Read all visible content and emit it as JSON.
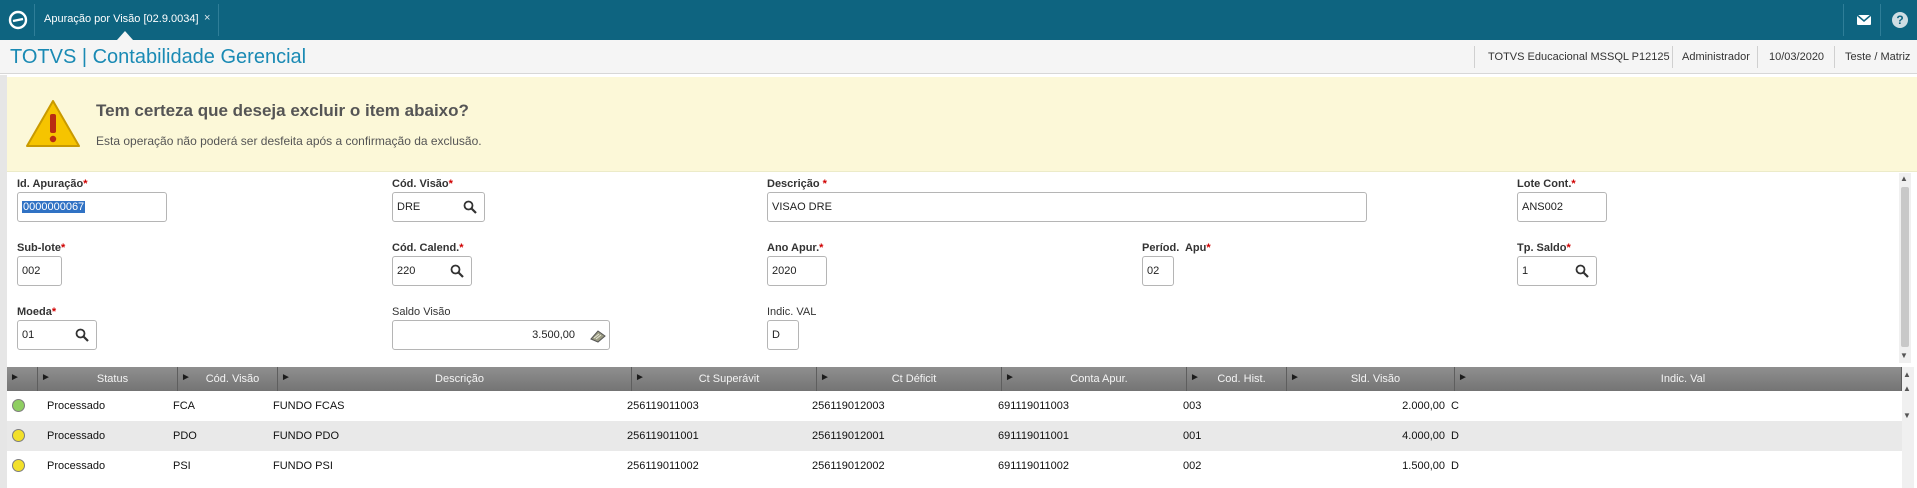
{
  "topbar": {
    "tab_label": "Apuração por Visão [02.9.0034]",
    "tab_close": "×",
    "color": "#0e6480"
  },
  "header": {
    "app_title": "TOTVS | Contabilidade Gerencial",
    "environment": "TOTVS Educacional MSSQL P12125",
    "user": "Administrador",
    "date": "10/03/2020",
    "branch": "Teste / Matriz"
  },
  "warning": {
    "title": "Tem certeza que deseja excluir o item abaixo?",
    "message": "Esta operação não poderá ser desfeita após a confirmação da exclusão.",
    "background": "#fcf8d8"
  },
  "form": {
    "id_apuracao": {
      "label": "Id. Apuração",
      "value": "0000000067"
    },
    "cod_visao": {
      "label": "Cód. Visão",
      "value": "DRE"
    },
    "descricao": {
      "label": "Descrição ",
      "value": "VISAO DRE"
    },
    "lote_cont": {
      "label": "Lote Cont.",
      "value": "ANS002"
    },
    "sub_lote": {
      "label": "Sub-lote",
      "value": "002"
    },
    "cod_calend": {
      "label": "Cód. Calend.",
      "value": "220"
    },
    "ano_apur": {
      "label": "Ano Apur.",
      "value": "2020"
    },
    "period_apu": {
      "label": "Períod.  Apu",
      "value": "02"
    },
    "tp_saldo": {
      "label": "Tp. Saldo",
      "value": "1"
    },
    "moeda": {
      "label": "Moeda",
      "value": "01"
    },
    "saldo_visao": {
      "label": "Saldo Visão",
      "value": "3.500,00"
    },
    "indic_val": {
      "label": "Indic. VAL",
      "value": "D"
    },
    "required_mark": "*"
  },
  "grid": {
    "columns": [
      "Status",
      "Cód. Visão",
      "Descrição",
      "Ct Superávit",
      "Ct Déficit",
      "Conta Apur.",
      "Cod. Hist.",
      "Sld. Visão",
      "Indic. Val"
    ],
    "rows": [
      {
        "status_color": "#8fce62",
        "status": "Processado",
        "cod_visao": "FCA",
        "descricao": "FUNDO FCAS",
        "ct_superavit": "256119011003",
        "ct_deficit": "256119012003",
        "conta_apur": "691119011003",
        "cod_hist": "003",
        "sld_visao": "2.000,00",
        "indic_val": "C"
      },
      {
        "status_color": "#f2e02a",
        "status": "Processado",
        "cod_visao": "PDO",
        "descricao": "FUNDO PDO",
        "ct_superavit": "256119011001",
        "ct_deficit": "256119012001",
        "conta_apur": "691119011001",
        "cod_hist": "001",
        "sld_visao": "4.000,00",
        "indic_val": "D"
      },
      {
        "status_color": "#f2e02a",
        "status": "Processado",
        "cod_visao": "PSI",
        "descricao": "FUNDO PSI",
        "ct_superavit": "256119011002",
        "ct_deficit": "256119012002",
        "conta_apur": "691119011002",
        "cod_hist": "002",
        "sld_visao": "1.500,00",
        "indic_val": "D"
      }
    ]
  },
  "icons": {
    "logo": "totvs-logo-icon",
    "mail": "mail-icon",
    "help": "help-icon",
    "warning": "warning-icon",
    "lookup": "search-icon",
    "calculator": "calculator-icon"
  }
}
